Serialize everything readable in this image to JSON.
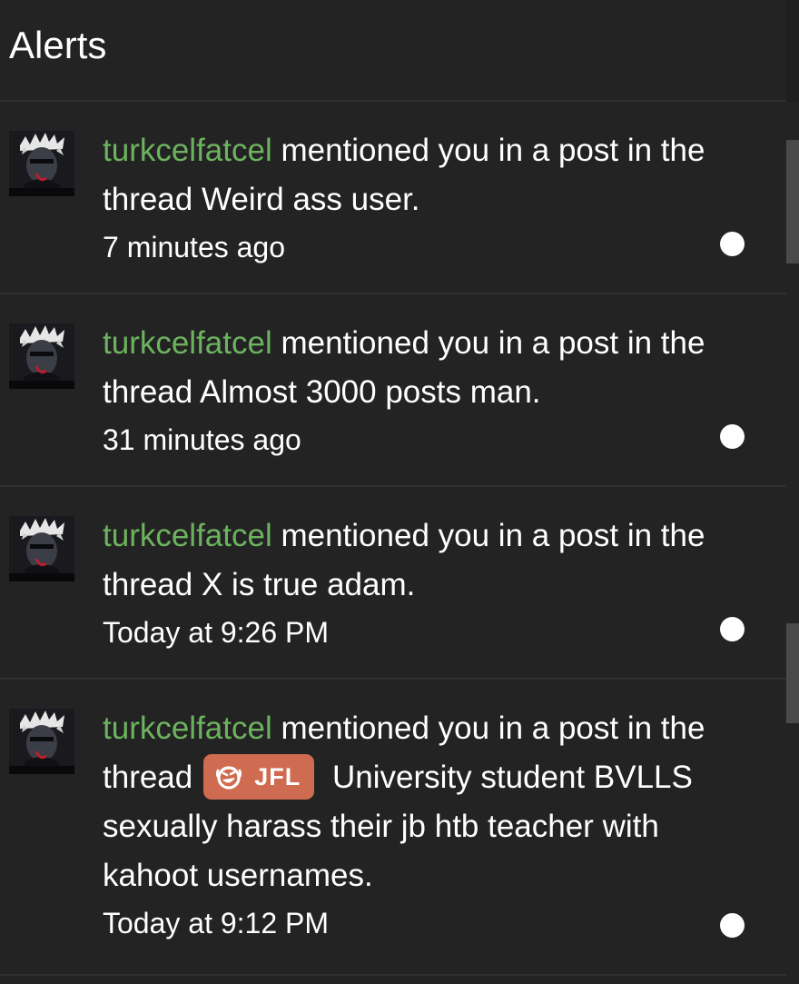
{
  "header": {
    "title": "Alerts"
  },
  "alerts": [
    {
      "username": "turkcelfatcel",
      "action": " mentioned you in a post in the thread ",
      "prefix": "",
      "thread": "Weird ass user.",
      "time": "7 minutes ago"
    },
    {
      "username": "turkcelfatcel",
      "action": " mentioned you in a post in the thread ",
      "prefix": "",
      "thread": "Almost 3000 posts man.",
      "time": "31 minutes ago"
    },
    {
      "username": "turkcelfatcel",
      "action": " mentioned you in a post in the thread ",
      "prefix": "",
      "thread": "X is true adam.",
      "time": "Today at 9:26 PM"
    },
    {
      "username": "turkcelfatcel",
      "action": " mentioned you in a post in the thread",
      "prefix": "JFL",
      "thread": " University student BVLLS sexually harass their jb htb teacher with kahoot usernames.",
      "time": "Today at 9:12 PM"
    }
  ],
  "colors": {
    "background": "#232323",
    "username": "#6db35f",
    "prefix_badge": "#cf6b50",
    "text": "#ffffff"
  },
  "icons": {
    "avatar": "user-avatar-image",
    "unread": "unread-dot-icon",
    "prefix": "laughing-emoji-icon"
  }
}
